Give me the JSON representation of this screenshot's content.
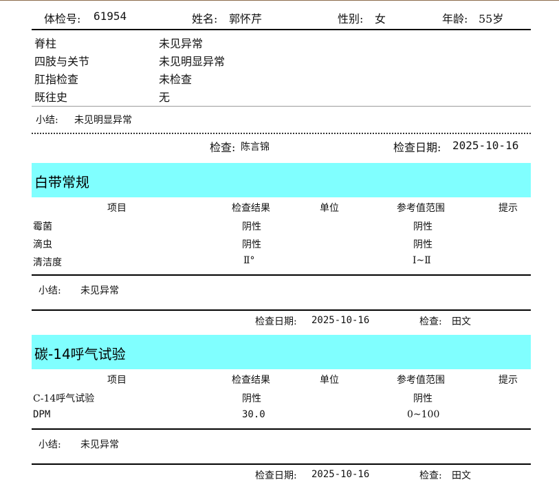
{
  "header": {
    "id_label": "体检号:",
    "id_value": "61954",
    "name_label": "姓名:",
    "name_value": "郭怀芹",
    "sex_label": "性别:",
    "sex_value": "女",
    "age_label": "年龄:",
    "age_value": "55岁"
  },
  "exam_general": {
    "items": [
      {
        "name": "脊柱",
        "result": "未见异常"
      },
      {
        "name": "四肢与关节",
        "result": "未见明显异常"
      },
      {
        "name": "肛指检查",
        "result": "未检查"
      },
      {
        "name": "既往史",
        "result": "无"
      }
    ],
    "summary_label": "小结:",
    "summary_value": "未见明显异常",
    "examiner_label": "检查:",
    "examiner_value": "陈言锦",
    "date_label": "检查日期:",
    "date_value": "2025-10-16"
  },
  "columns": {
    "item": "项目",
    "result": "检查结果",
    "unit": "单位",
    "range": "参考值范围",
    "hint": "提示"
  },
  "leucorrhea": {
    "title": "白带常规",
    "rows": [
      {
        "name": "霉菌",
        "result": "阴性",
        "unit": "",
        "range": "阴性",
        "hint": ""
      },
      {
        "name": "滴虫",
        "result": "阴性",
        "unit": "",
        "range": "阴性",
        "hint": ""
      },
      {
        "name": "清洁度",
        "result": "Ⅱ°",
        "unit": "",
        "range": "Ⅰ~Ⅱ",
        "hint": ""
      }
    ],
    "summary_label": "小结:",
    "summary_value": "未见异常",
    "date_label": "检查日期:",
    "date_value": "2025-10-16",
    "examiner_label": "检查:",
    "examiner_value": "田文"
  },
  "c14": {
    "title": "碳-14呼气试验",
    "rows": [
      {
        "name": "C-14呼气试验",
        "result": "阴性",
        "unit": "",
        "range": "阴性",
        "hint": ""
      },
      {
        "name": "DPM",
        "result": "30.0",
        "unit": "",
        "range": "0~100",
        "hint": ""
      }
    ],
    "summary_label": "小结:",
    "summary_value": "未见异常",
    "date_label": "检查日期:",
    "date_value": "2025-10-16",
    "examiner_label": "检查:",
    "examiner_value": "田文"
  }
}
